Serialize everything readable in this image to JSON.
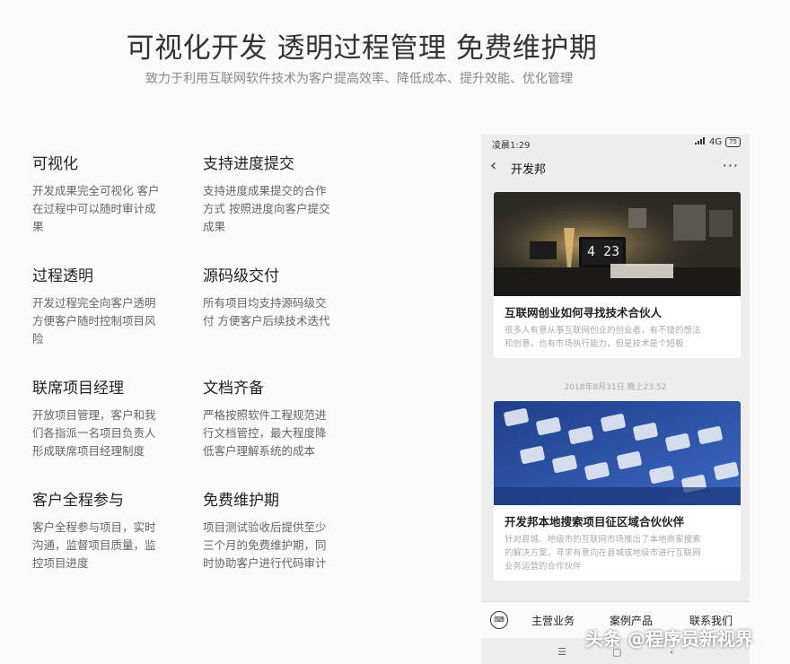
{
  "hero": {
    "title": "可视化开发 透明过程管理 免费维护期",
    "subtitle": "致力于利用互联网软件技术为客户提高效率、降低成本、提升效能、优化管理"
  },
  "features": [
    {
      "title": "可视化",
      "lines": [
        "开发成果完全可视化 客户",
        "在过程中可以随时审计成",
        "果"
      ]
    },
    {
      "title": "支持进度提交",
      "lines": [
        "支持进度成果提交的合作",
        "方式 按照进度向客户提交",
        "成果"
      ]
    },
    {
      "title": "过程透明",
      "lines": [
        "开发过程完全向客户透明",
        "方便客户随时控制项目风",
        "险"
      ]
    },
    {
      "title": "源码级交付",
      "lines": [
        "所有项目均支持源码级交",
        "付 方便客户后续技术迭代"
      ]
    },
    {
      "title": "联席项目经理",
      "lines": [
        "开放项目管理，客户和我",
        "们各指派一名项目负责人",
        "形成联席项目经理制度"
      ]
    },
    {
      "title": "文档齐备",
      "lines": [
        "严格按照软件工程规范进",
        "行文档管控，最大程度降",
        "低客户理解系统的成本"
      ]
    },
    {
      "title": "客户全程参与",
      "lines": [
        "客户全程参与项目，实时",
        "沟通，监督项目质量，监",
        "控项目进度"
      ]
    },
    {
      "title": "免费维护期",
      "lines": [
        "项目测试验收后提供至少",
        "三个月的免费维护期，同",
        "时协助客户进行代码审计"
      ]
    }
  ],
  "phone": {
    "status_time": "凌晨1:29",
    "status_signal": "4G",
    "status_battery": "75",
    "nav_title": "开发邦",
    "back_glyph": "‹",
    "more_glyph": "···",
    "card1": {
      "clock": "4 23",
      "title": "互联网创业如何寻找技术合伙人",
      "lines": [
        "很多人有意从事互联网创业的创业者，有不错的想法",
        "和创意，也有市场执行能力，但是技术是个短板"
      ]
    },
    "timestamp": "2018年8月31日 晚上23:52",
    "card2": {
      "title": "开发邦本地搜索项目征区域合伙伙伴",
      "lines": [
        "针对县城、地级市的互联网市场推出了本地商家搜索",
        "的解决方案，寻求有意向在县城或地级市进行互联网",
        "业务运营的合作伙伴"
      ]
    },
    "tabs": [
      "主营业务",
      "案例产品",
      "联系我们"
    ],
    "keyboard_glyph": "⌨",
    "sysnav": [
      "☰",
      "▢",
      "‹"
    ]
  },
  "watermark": "头条 @程序员新视界",
  "colors": {
    "accent": "#333333",
    "phone_bg": "#ededed",
    "card2_img": "#2b4f9e"
  }
}
